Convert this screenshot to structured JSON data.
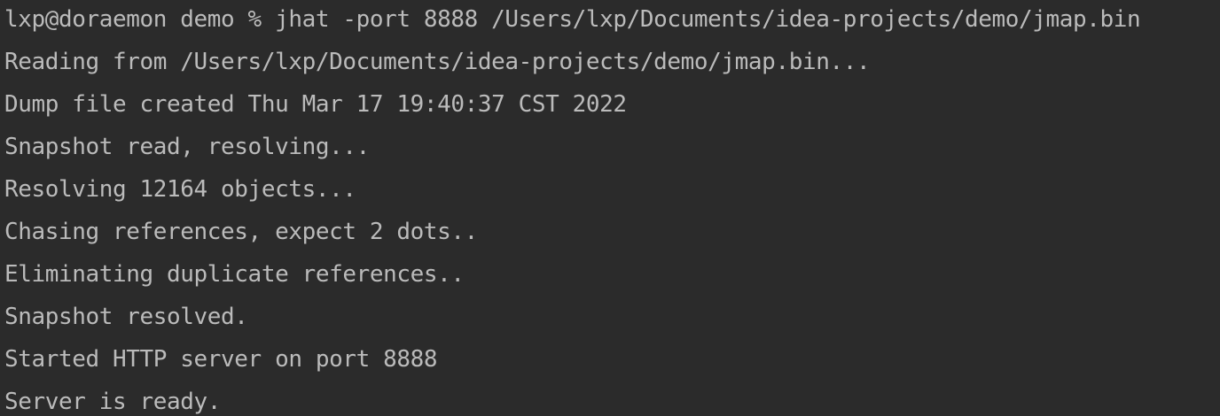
{
  "terminal": {
    "lines": [
      "lxp@doraemon demo % jhat -port 8888 /Users/lxp/Documents/idea-projects/demo/jmap.bin",
      "Reading from /Users/lxp/Documents/idea-projects/demo/jmap.bin...",
      "Dump file created Thu Mar 17 19:40:37 CST 2022",
      "Snapshot read, resolving...",
      "Resolving 12164 objects...",
      "Chasing references, expect 2 dots..",
      "Eliminating duplicate references..",
      "Snapshot resolved.",
      "Started HTTP server on port 8888",
      "Server is ready."
    ]
  },
  "colors": {
    "background": "#2b2b2b",
    "text": "#bbbbbb"
  }
}
